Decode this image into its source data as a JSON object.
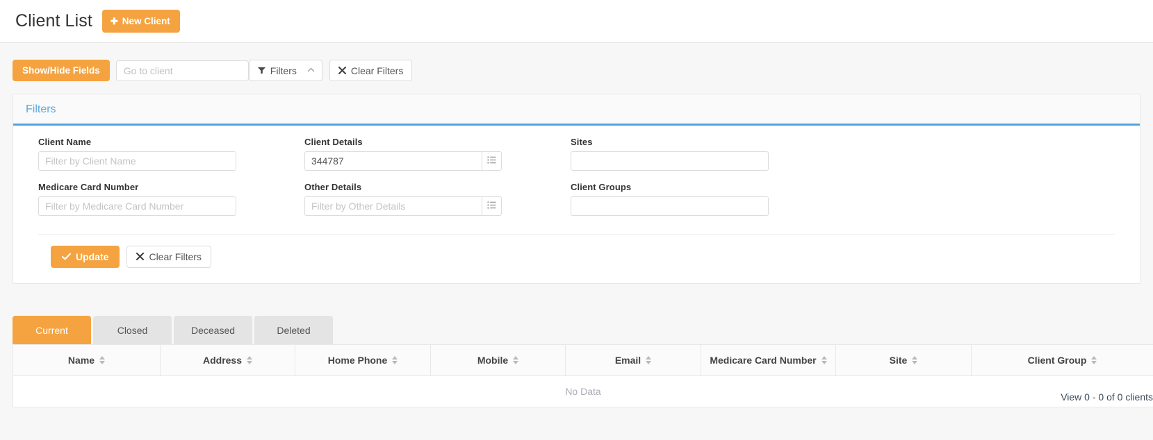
{
  "header": {
    "title": "Client List",
    "new_client_label": "New Client",
    "plus_glyph": "✚"
  },
  "toolbar": {
    "show_hide_fields_label": "Show/Hide Fields",
    "goto_client_value": "",
    "goto_client_placeholder": "Go to client",
    "filters_label": "Filters",
    "filters_caret": "⌃",
    "clear_filters_label": "Clear Filters",
    "funnel_glyph": "▼",
    "x_glyph": "✖"
  },
  "filters_panel": {
    "title": "Filters",
    "fields": [
      {
        "label": "Client Name",
        "value": "",
        "placeholder": "Filter by Client Name",
        "has_append": false
      },
      {
        "label": "Client Details",
        "value": "344787",
        "placeholder": "",
        "has_append": true
      },
      {
        "label": "Sites",
        "value": "",
        "placeholder": "",
        "has_append": false
      },
      {
        "label": "Medicare Card Number",
        "value": "",
        "placeholder": "Filter by Medicare Card Number",
        "has_append": false
      },
      {
        "label": "Other Details",
        "value": "",
        "placeholder": "Filter by Other Details",
        "has_append": true
      },
      {
        "label": "Client Groups",
        "value": "",
        "placeholder": "",
        "has_append": false
      }
    ],
    "update_label": "Update",
    "check_glyph": "✔",
    "clear_filters_label": "Clear Filters",
    "x_glyph": "✖"
  },
  "tabs": [
    {
      "label": "Current",
      "active": true
    },
    {
      "label": "Closed",
      "active": false
    },
    {
      "label": "Deceased",
      "active": false
    },
    {
      "label": "Deleted",
      "active": false
    }
  ],
  "table": {
    "view_count_text": "View 0 - 0 of 0 clients",
    "columns": [
      "Name",
      "Address",
      "Home Phone",
      "Mobile",
      "Email",
      "Medicare Card Number",
      "Site",
      "Client Group"
    ],
    "empty_text": "No Data"
  },
  "colors": {
    "accent_orange": "#f4a340",
    "panel_blue": "#4fa3e3",
    "title_blue": "#5ba7e0"
  }
}
